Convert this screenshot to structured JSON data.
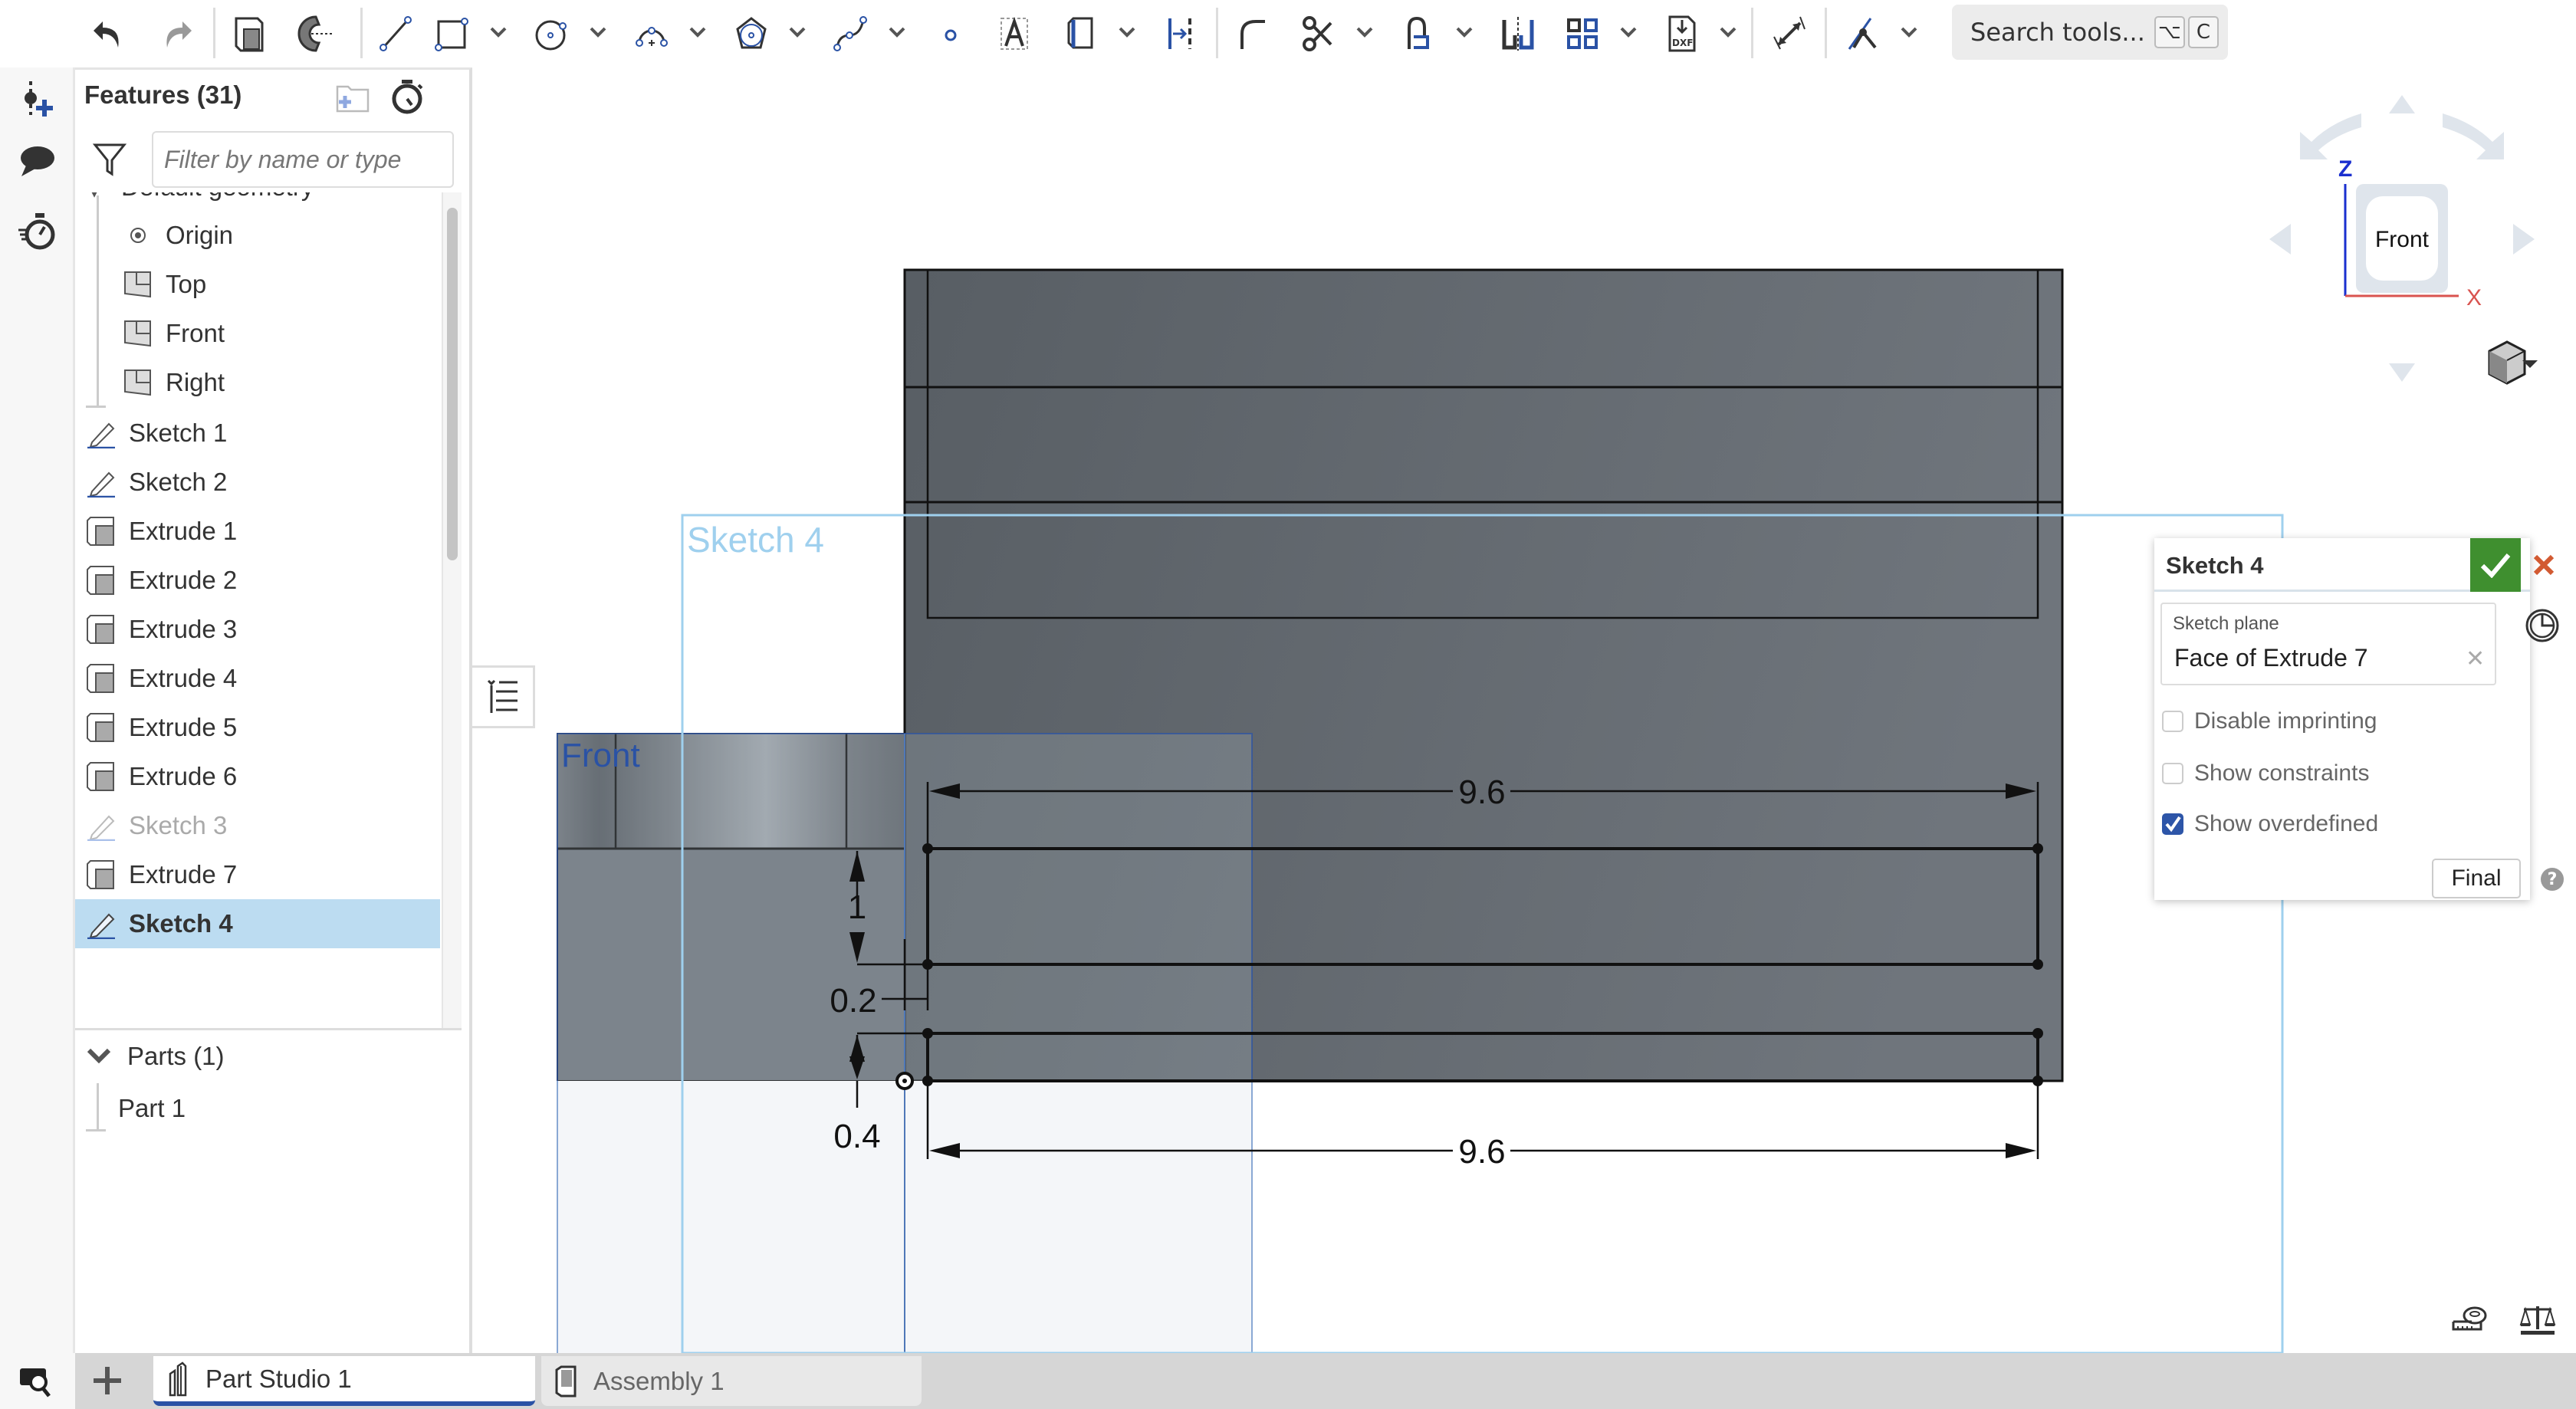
{
  "toolbar": {
    "tools": [
      {
        "name": "feature-list-toggle",
        "icon": "feature-tree-icon"
      },
      {
        "name": "undo",
        "icon": "undo-icon"
      },
      {
        "name": "redo",
        "icon": "redo-icon"
      },
      {
        "name": "extrude",
        "icon": "extrude-icon"
      },
      {
        "name": "revolve",
        "icon": "revolve-icon"
      },
      {
        "name": "line",
        "icon": "line-icon"
      },
      {
        "name": "rectangle",
        "icon": "rectangle-icon",
        "has_dropdown": true
      },
      {
        "name": "circle",
        "icon": "circle-icon",
        "has_dropdown": true
      },
      {
        "name": "arc",
        "icon": "arc-icon",
        "has_dropdown": true
      },
      {
        "name": "polygon",
        "icon": "polygon-icon",
        "has_dropdown": true
      },
      {
        "name": "spline",
        "icon": "spline-icon",
        "has_dropdown": true
      },
      {
        "name": "point",
        "icon": "point-icon"
      },
      {
        "name": "text",
        "icon": "text-icon"
      },
      {
        "name": "construction",
        "icon": "construction-icon",
        "has_dropdown": true
      },
      {
        "name": "offset",
        "icon": "offset-icon"
      },
      {
        "name": "fillet",
        "icon": "sketch-fillet-icon"
      },
      {
        "name": "trim",
        "icon": "trim-icon",
        "has_dropdown": true
      },
      {
        "name": "use",
        "icon": "use-icon",
        "has_dropdown": true
      },
      {
        "name": "mirror",
        "icon": "mirror-icon"
      },
      {
        "name": "pattern",
        "icon": "pattern-icon",
        "has_dropdown": true
      },
      {
        "name": "dxf-import",
        "icon": "dxf-icon",
        "has_dropdown": true
      },
      {
        "name": "dimension",
        "icon": "dimension-icon"
      },
      {
        "name": "constraint",
        "icon": "constraint-icon",
        "has_dropdown": true
      }
    ],
    "search": {
      "label": "Search tools...",
      "shortcut_keys": [
        "⌥",
        "C"
      ]
    }
  },
  "rail": {
    "items": [
      {
        "icon": "insert-mate-connector-icon"
      },
      {
        "icon": "comment-icon"
      },
      {
        "icon": "rollback-timer-icon"
      }
    ],
    "bottom_icon": "search-feature-icon"
  },
  "feature_panel": {
    "title": "Features (31)",
    "filter_placeholder": "Filter by name or type",
    "partial_group_label": "Default geometry",
    "items": [
      {
        "label": "Origin",
        "type": "origin",
        "child": true
      },
      {
        "label": "Top",
        "type": "plane",
        "child": true
      },
      {
        "label": "Front",
        "type": "plane",
        "child": true
      },
      {
        "label": "Right",
        "type": "plane",
        "child": true
      },
      {
        "label": "Sketch 1",
        "type": "sketch"
      },
      {
        "label": "Sketch 2",
        "type": "sketch"
      },
      {
        "label": "Extrude 1",
        "type": "extrude"
      },
      {
        "label": "Extrude 2",
        "type": "extrude"
      },
      {
        "label": "Extrude 3",
        "type": "extrude"
      },
      {
        "label": "Extrude 4",
        "type": "extrude"
      },
      {
        "label": "Extrude 5",
        "type": "extrude"
      },
      {
        "label": "Extrude 6",
        "type": "extrude"
      },
      {
        "label": "Sketch 3",
        "type": "sketch",
        "suppressed": true
      },
      {
        "label": "Extrude 7",
        "type": "extrude"
      },
      {
        "label": "Sketch 4",
        "type": "sketch",
        "selected": true
      }
    ],
    "parts_header": "Parts (1)",
    "parts": [
      "Part 1"
    ]
  },
  "viewport": {
    "sketch_label": "Sketch 4",
    "plane_label": "Front",
    "dimensions": {
      "top_width": "9.6",
      "bottom_width": "9.6",
      "height_upper": "1",
      "offset_gap": "0.2",
      "height_lower": "0.4"
    }
  },
  "view_cube": {
    "face": "Front",
    "axis_z": "Z",
    "axis_x": "X",
    "colors": {
      "z": "#1a2fcf",
      "x": "#d9534f"
    }
  },
  "sketch_panel": {
    "title": "Sketch 4",
    "plane_label": "Sketch plane",
    "plane_value": "Face of Extrude 7",
    "options": [
      {
        "label": "Disable imprinting",
        "checked": false
      },
      {
        "label": "Show constraints",
        "checked": false
      },
      {
        "label": "Show overdefined",
        "checked": true
      }
    ],
    "final_label": "Final",
    "help_label": "?",
    "colors": {
      "ok": "#3f8f2f",
      "cancel": "#d25a32"
    }
  },
  "tabs": [
    {
      "label": "Part Studio 1",
      "active": true
    },
    {
      "label": "Assembly 1",
      "active": false
    }
  ],
  "colors": {
    "accent": "#2a52a5",
    "selection": "#bcdcf1",
    "sketch_blue": "#9fd0ee"
  }
}
